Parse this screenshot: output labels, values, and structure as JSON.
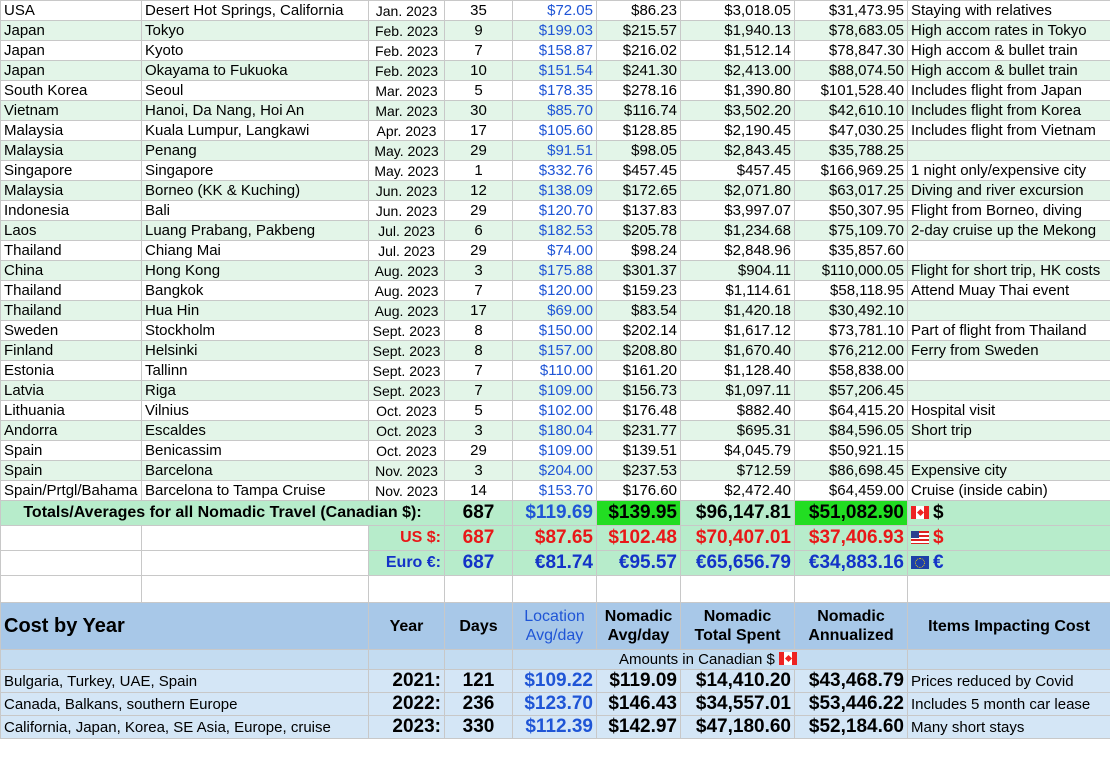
{
  "travel_rows": [
    [
      "USA",
      "Desert Hot Springs, California",
      "Jan. 2023",
      "35",
      "$72.05",
      "$86.23",
      "$3,018.05",
      "$31,473.95",
      "Staying with relatives"
    ],
    [
      "Japan",
      "Tokyo",
      "Feb. 2023",
      "9",
      "$199.03",
      "$215.57",
      "$1,940.13",
      "$78,683.05",
      "High accom rates in Tokyo"
    ],
    [
      "Japan",
      "Kyoto",
      "Feb. 2023",
      "7",
      "$158.87",
      "$216.02",
      "$1,512.14",
      "$78,847.30",
      "High accom & bullet train"
    ],
    [
      "Japan",
      "Okayama to Fukuoka",
      "Feb. 2023",
      "10",
      "$151.54",
      "$241.30",
      "$2,413.00",
      "$88,074.50",
      "High accom & bullet train"
    ],
    [
      "South Korea",
      "Seoul",
      "Mar. 2023",
      "5",
      "$178.35",
      "$278.16",
      "$1,390.80",
      "$101,528.40",
      "Includes flight from Japan"
    ],
    [
      "Vietnam",
      "Hanoi, Da Nang, Hoi An",
      "Mar. 2023",
      "30",
      "$85.70",
      "$116.74",
      "$3,502.20",
      "$42,610.10",
      "Includes flight from Korea"
    ],
    [
      "Malaysia",
      "Kuala Lumpur, Langkawi",
      "Apr. 2023",
      "17",
      "$105.60",
      "$128.85",
      "$2,190.45",
      "$47,030.25",
      "Includes flight from Vietnam"
    ],
    [
      "Malaysia",
      "Penang",
      "May. 2023",
      "29",
      "$91.51",
      "$98.05",
      "$2,843.45",
      "$35,788.25",
      ""
    ],
    [
      "Singapore",
      "Singapore",
      "May. 2023",
      "1",
      "$332.76",
      "$457.45",
      "$457.45",
      "$166,969.25",
      "1 night only/expensive city"
    ],
    [
      "Malaysia",
      "Borneo (KK & Kuching)",
      "Jun. 2023",
      "12",
      "$138.09",
      "$172.65",
      "$2,071.80",
      "$63,017.25",
      "Diving and river excursion"
    ],
    [
      "Indonesia",
      "Bali",
      "Jun. 2023",
      "29",
      "$120.70",
      "$137.83",
      "$3,997.07",
      "$50,307.95",
      "Flight from Borneo, diving"
    ],
    [
      "Laos",
      "Luang Prabang, Pakbeng",
      "Jul. 2023",
      "6",
      "$182.53",
      "$205.78",
      "$1,234.68",
      "$75,109.70",
      "2-day cruise up the Mekong"
    ],
    [
      "Thailand",
      "Chiang Mai",
      "Jul. 2023",
      "29",
      "$74.00",
      "$98.24",
      "$2,848.96",
      "$35,857.60",
      ""
    ],
    [
      "China",
      "Hong Kong",
      "Aug. 2023",
      "3",
      "$175.88",
      "$301.37",
      "$904.11",
      "$110,000.05",
      "Flight for short trip, HK costs"
    ],
    [
      "Thailand",
      "Bangkok",
      "Aug. 2023",
      "7",
      "$120.00",
      "$159.23",
      "$1,114.61",
      "$58,118.95",
      "Attend Muay Thai event"
    ],
    [
      "Thailand",
      "Hua Hin",
      "Aug. 2023",
      "17",
      "$69.00",
      "$83.54",
      "$1,420.18",
      "$30,492.10",
      ""
    ],
    [
      "Sweden",
      "Stockholm",
      "Sept. 2023",
      "8",
      "$150.00",
      "$202.14",
      "$1,617.12",
      "$73,781.10",
      "Part of flight from Thailand"
    ],
    [
      "Finland",
      "Helsinki",
      "Sept. 2023",
      "8",
      "$157.00",
      "$208.80",
      "$1,670.40",
      "$76,212.00",
      "Ferry from Sweden"
    ],
    [
      "Estonia",
      "Tallinn",
      "Sept. 2023",
      "7",
      "$110.00",
      "$161.20",
      "$1,128.40",
      "$58,838.00",
      ""
    ],
    [
      "Latvia",
      "Riga",
      "Sept. 2023",
      "7",
      "$109.00",
      "$156.73",
      "$1,097.11",
      "$57,206.45",
      ""
    ],
    [
      "Lithuania",
      "Vilnius",
      "Oct. 2023",
      "5",
      "$102.00",
      "$176.48",
      "$882.40",
      "$64,415.20",
      "Hospital visit"
    ],
    [
      "Andorra",
      "Escaldes",
      "Oct. 2023",
      "3",
      "$180.04",
      "$231.77",
      "$695.31",
      "$84,596.05",
      "Short trip"
    ],
    [
      "Spain",
      "Benicassim",
      "Oct. 2023",
      "29",
      "$109.00",
      "$139.51",
      "$4,045.79",
      "$50,921.15",
      ""
    ],
    [
      "Spain",
      "Barcelona",
      "Nov. 2023",
      "3",
      "$204.00",
      "$237.53",
      "$712.59",
      "$86,698.45",
      "Expensive city"
    ],
    [
      "Spain/Prtgl/Bahama",
      "Barcelona to Tampa Cruise",
      "Nov. 2023",
      "14",
      "$153.70",
      "$176.60",
      "$2,472.40",
      "$64,459.00",
      "Cruise (inside cabin)"
    ]
  ],
  "totals": {
    "label": "Totals/Averages for all Nomadic Travel (Canadian $):",
    "days": "687",
    "loc_avg": "$119.69",
    "nom_avg": "$139.95",
    "total": "$96,147.81",
    "annualized": "$51,082.90",
    "currency_symbol": "$"
  },
  "us": {
    "label": "US $:",
    "days": "687",
    "loc_avg": "$87.65",
    "nom_avg": "$102.48",
    "total": "$70,407.01",
    "annualized": "$37,406.93",
    "currency_symbol": "$"
  },
  "euro": {
    "label": "Euro €:",
    "days": "687",
    "loc_avg": "€81.74",
    "nom_avg": "€95.57",
    "total": "€65,656.79",
    "annualized": "€34,883.16",
    "currency_symbol": "€"
  },
  "cost_by_year": {
    "title": "Cost by Year",
    "headers": {
      "year": "Year",
      "days": "Days",
      "loc_line1": "Location",
      "loc_line2": "Avg/day",
      "nom_line1": "Nomadic",
      "nom_line2": "Avg/day",
      "total_line1": "Nomadic",
      "total_line2": "Total Spent",
      "ann_line1": "Nomadic",
      "ann_line2": "Annualized",
      "items": "Items Impacting Cost"
    },
    "amounts_note": "Amounts in Canadian $",
    "rows": [
      [
        "Bulgaria, Turkey, UAE, Spain",
        "2021:",
        "121",
        "$109.22",
        "$119.09",
        "$14,410.20",
        "$43,468.79",
        "Prices reduced by Covid"
      ],
      [
        "Canada, Balkans, southern Europe",
        "2022:",
        "236",
        "$123.70",
        "$146.43",
        "$34,557.01",
        "$53,446.22",
        "Includes 5 month car lease"
      ],
      [
        "California, Japan, Korea, SE Asia, Europe, cruise",
        "2023:",
        "330",
        "$112.39",
        "$142.97",
        "$47,180.60",
        "$52,184.60",
        "Many short stays"
      ]
    ]
  },
  "colors": {
    "row_alt": "#e3f5e8",
    "totals_bg": "#b7eccb",
    "highlight_green": "#22dd22",
    "blue_values": "#1f55d6",
    "us_red": "#e81818",
    "euro_blue": "#1333c8",
    "header_blue": "#a8c8e8"
  }
}
